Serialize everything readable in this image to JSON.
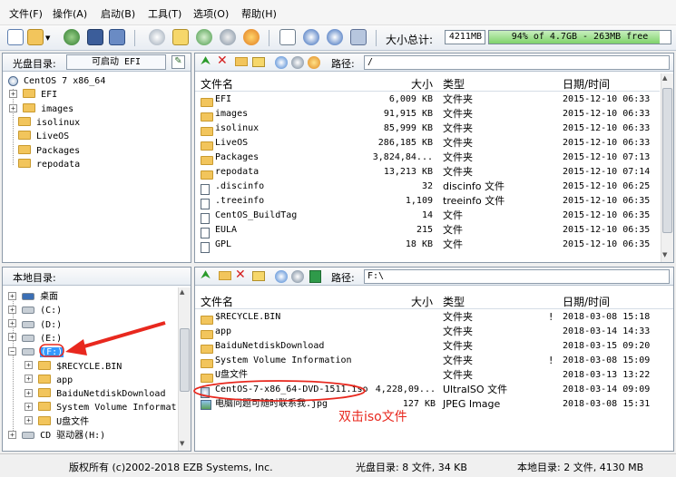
{
  "menu": [
    "文件(F)",
    "操作(A)",
    "启动(B)",
    "工具(T)",
    "选项(O)",
    "帮助(H)"
  ],
  "toolbar": {
    "capacity_label": "大小总计:",
    "capacity_value": "4211MB",
    "capacity_fill_percent": 94,
    "capacity_text": "94% of 4.7GB - 263MB free"
  },
  "disc_panel": {
    "label": "光盘目录:",
    "boot_label": "可启动 EFI",
    "path_label": "路径:",
    "path_value": "/",
    "tree": {
      "root": "CentOS 7 x86_64",
      "children": [
        "EFI",
        "images",
        "isolinux",
        "LiveOS",
        "Packages",
        "repodata"
      ]
    },
    "columns": [
      "文件名",
      "大小",
      "类型",
      "日期/时间"
    ],
    "files": [
      {
        "name": "EFI",
        "size": "6,009 KB",
        "type": "文件夹",
        "date": "2015-12-10 06:33",
        "icon": "folder"
      },
      {
        "name": "images",
        "size": "91,915 KB",
        "type": "文件夹",
        "date": "2015-12-10 06:33",
        "icon": "folder"
      },
      {
        "name": "isolinux",
        "size": "85,999 KB",
        "type": "文件夹",
        "date": "2015-12-10 06:33",
        "icon": "folder"
      },
      {
        "name": "LiveOS",
        "size": "286,185 KB",
        "type": "文件夹",
        "date": "2015-12-10 06:33",
        "icon": "folder"
      },
      {
        "name": "Packages",
        "size": "3,824,84...",
        "type": "文件夹",
        "date": "2015-12-10 07:13",
        "icon": "folder"
      },
      {
        "name": "repodata",
        "size": "13,213 KB",
        "type": "文件夹",
        "date": "2015-12-10 07:14",
        "icon": "folder"
      },
      {
        "name": ".discinfo",
        "size": "32",
        "type": "discinfo 文件",
        "date": "2015-12-10 06:25",
        "icon": "file"
      },
      {
        "name": ".treeinfo",
        "size": "1,109",
        "type": "treeinfo 文件",
        "date": "2015-12-10 06:35",
        "icon": "file"
      },
      {
        "name": "CentOS_BuildTag",
        "size": "14",
        "type": "文件",
        "date": "2015-12-10 06:35",
        "icon": "file"
      },
      {
        "name": "EULA",
        "size": "215",
        "type": "文件",
        "date": "2015-12-10 06:35",
        "icon": "file"
      },
      {
        "name": "GPL",
        "size": "18 KB",
        "type": "文件",
        "date": "2015-12-10 06:35",
        "icon": "file"
      }
    ]
  },
  "local_panel": {
    "label": "本地目录:",
    "path_label": "路径:",
    "path_value": "F:\\",
    "tree": [
      {
        "label": "桌面",
        "kind": "desktop",
        "level": 0
      },
      {
        "label": "(C:)",
        "kind": "drive",
        "level": 0
      },
      {
        "label": "(D:)",
        "kind": "drive",
        "level": 0
      },
      {
        "label": "(E:)",
        "kind": "drive",
        "level": 0
      },
      {
        "label": "(F:)",
        "kind": "drive",
        "level": 0,
        "selected": true
      },
      {
        "label": "$RECYCLE.BIN",
        "kind": "folder",
        "level": 1
      },
      {
        "label": "app",
        "kind": "folder",
        "level": 1
      },
      {
        "label": "BaiduNetdiskDownload",
        "kind": "folder",
        "level": 1
      },
      {
        "label": "System Volume Informat:",
        "kind": "folder",
        "level": 1
      },
      {
        "label": "U盘文件",
        "kind": "folder",
        "level": 1
      },
      {
        "label": "CD 驱动器(H:)",
        "kind": "cd",
        "level": 0
      }
    ],
    "columns": [
      "文件名",
      "大小",
      "类型",
      "日期/时间"
    ],
    "files": [
      {
        "name": "$RECYCLE.BIN",
        "size": "",
        "type": "文件夹",
        "flag": "!",
        "date": "2018-03-08 15:18",
        "icon": "folder"
      },
      {
        "name": "app",
        "size": "",
        "type": "文件夹",
        "flag": "",
        "date": "2018-03-14 14:33",
        "icon": "folder"
      },
      {
        "name": "BaiduNetdiskDownload",
        "size": "",
        "type": "文件夹",
        "flag": "",
        "date": "2018-03-15 09:20",
        "icon": "folder"
      },
      {
        "name": "System Volume Information",
        "size": "",
        "type": "文件夹",
        "flag": "!",
        "date": "2018-03-08 15:09",
        "icon": "folder"
      },
      {
        "name": "U盘文件",
        "size": "",
        "type": "文件夹",
        "flag": "",
        "date": "2018-03-13 13:22",
        "icon": "folder"
      },
      {
        "name": "CentOS-7-x86_64-DVD-1511.iso",
        "size": "4,228,09...",
        "type": "UltraISO 文件",
        "flag": "",
        "date": "2018-03-14 09:09",
        "icon": "iso"
      },
      {
        "name": "电脑问题可随时联系我.jpg",
        "size": "127 KB",
        "type": "JPEG Image",
        "flag": "",
        "date": "2018-03-08 15:31",
        "icon": "image"
      }
    ]
  },
  "annotation": {
    "text": "双击iso文件",
    "color": "#e8281e"
  },
  "status": {
    "copyright": "版权所有 (c)2002-2018 EZB Systems, Inc.",
    "disc": "光盘目录: 8 文件, 34 KB",
    "local": "本地目录: 2 文件, 4130 MB"
  }
}
